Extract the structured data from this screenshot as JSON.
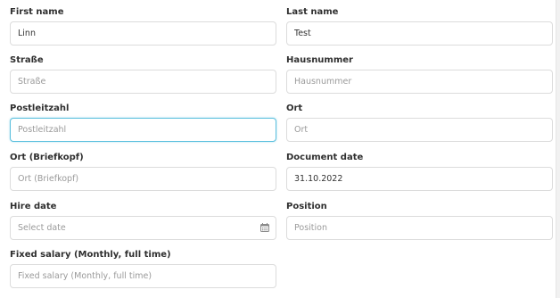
{
  "form": {
    "first_name": {
      "label": "First name",
      "value": "Linn",
      "placeholder": ""
    },
    "last_name": {
      "label": "Last name",
      "value": "Test",
      "placeholder": ""
    },
    "strasse": {
      "label": "Straße",
      "value": "",
      "placeholder": "Straße"
    },
    "hausnummer": {
      "label": "Hausnummer",
      "value": "",
      "placeholder": "Hausnummer"
    },
    "postleitzahl": {
      "label": "Postleitzahl",
      "value": "",
      "placeholder": "Postleitzahl"
    },
    "ort": {
      "label": "Ort",
      "value": "",
      "placeholder": "Ort"
    },
    "ort_briefkopf": {
      "label": "Ort (Briefkopf)",
      "value": "",
      "placeholder": "Ort (Briefkopf)"
    },
    "document_date": {
      "label": "Document date",
      "value": "31.10.2022",
      "placeholder": ""
    },
    "hire_date": {
      "label": "Hire date",
      "value": "",
      "placeholder": "Select date",
      "icon": "calendar-icon"
    },
    "position": {
      "label": "Position",
      "value": "",
      "placeholder": "Position"
    },
    "fixed_salary": {
      "label": "Fixed salary (Monthly, full time)",
      "value": "",
      "placeholder": "Fixed salary (Monthly, full time)"
    }
  },
  "colors": {
    "focus_border": "#5bc0de",
    "input_border": "#dcdcdc",
    "placeholder": "#9a9a9a"
  }
}
